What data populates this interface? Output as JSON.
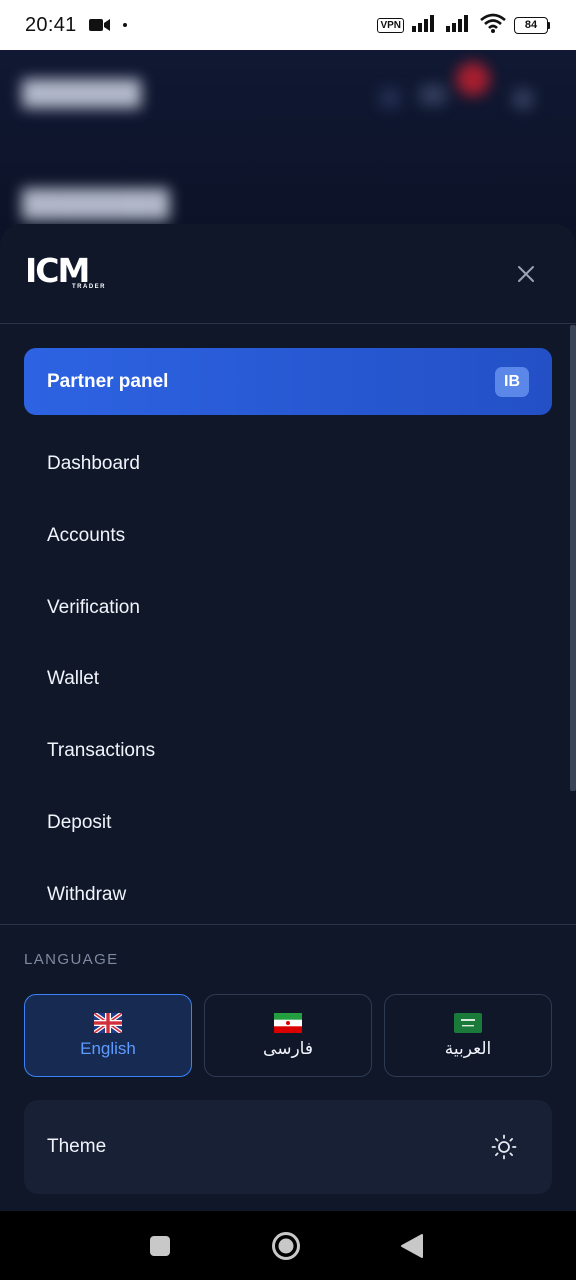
{
  "status_bar": {
    "time": "20:41",
    "vpn": "VPN",
    "battery": "84",
    "icons": [
      "video-camera-icon",
      "dot-icon",
      "vpn-icon",
      "signal-icon",
      "signal-icon",
      "wifi-icon",
      "battery-icon"
    ]
  },
  "drawer": {
    "logo_text": "ICM",
    "logo_subtext": "TRADER",
    "close_icon": "close-icon",
    "partner_panel": {
      "label": "Partner panel",
      "badge": "IB"
    },
    "nav_items": [
      {
        "label": "Dashboard"
      },
      {
        "label": "Accounts"
      },
      {
        "label": "Verification"
      },
      {
        "label": "Wallet"
      },
      {
        "label": "Transactions"
      },
      {
        "label": "Deposit"
      },
      {
        "label": "Withdraw"
      }
    ],
    "language": {
      "heading": "LANGUAGE",
      "options": [
        {
          "label": "English",
          "flag": "uk-flag-icon",
          "active": true
        },
        {
          "label": "فارسی",
          "flag": "iran-flag-icon",
          "active": false
        },
        {
          "label": "العربية",
          "flag": "saudi-flag-icon",
          "active": false
        }
      ]
    },
    "theme": {
      "label": "Theme",
      "icon": "sun-icon"
    }
  },
  "colors": {
    "drawer_bg": "#0f1729",
    "accent": "#2d63e2",
    "active_lang": "#5d9bff"
  },
  "android_nav": {
    "icons": [
      "recent-apps-icon",
      "home-icon",
      "back-icon"
    ]
  }
}
